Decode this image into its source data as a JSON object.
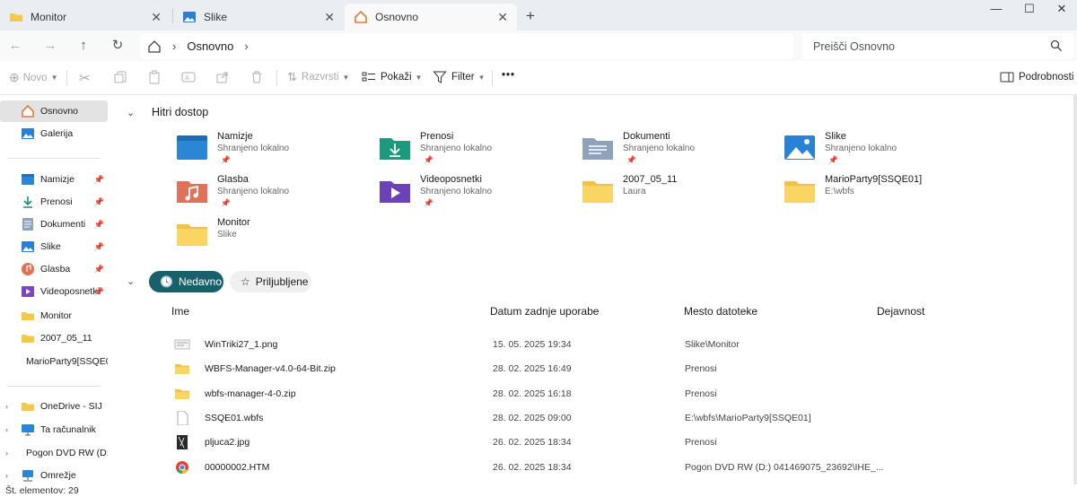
{
  "tabs": [
    {
      "label": "Monitor",
      "icon": "folder-icon"
    },
    {
      "label": "Slike",
      "icon": "pictures-icon"
    },
    {
      "label": "Osnovno",
      "icon": "home-icon"
    }
  ],
  "window_controls": {
    "minimize": "—",
    "maximize": "☐",
    "close": "✕"
  },
  "address": {
    "segment": "Osnovno"
  },
  "search": {
    "placeholder": "Preišči Osnovno"
  },
  "toolbar": {
    "new_label": "Novo",
    "sort_label": "Razvrsti",
    "view_label": "Pokaži",
    "filter_label": "Filter",
    "more_label": "•••",
    "details_label": "Podrobnosti"
  },
  "sidebar": {
    "items": [
      {
        "label": "Osnovno",
        "icon": "home-icon"
      },
      {
        "label": "Galerija",
        "icon": "gallery-icon"
      },
      {
        "label": "Namizje",
        "icon": "desktop-icon"
      },
      {
        "label": "Prenosi",
        "icon": "downloads-icon"
      },
      {
        "label": "Dokumenti",
        "icon": "documents-icon"
      },
      {
        "label": "Slike",
        "icon": "pictures-icon"
      },
      {
        "label": "Glasba",
        "icon": "music-icon"
      },
      {
        "label": "Videoposnetki",
        "icon": "videos-icon"
      },
      {
        "label": "Monitor",
        "icon": "folder-icon"
      },
      {
        "label": "2007_05_11",
        "icon": "folder-icon"
      },
      {
        "label": "MarioParty9[SSQE0",
        "icon": "folder-icon"
      },
      {
        "label": "OneDrive - SIJ",
        "icon": "onedrive-icon"
      },
      {
        "label": "Ta računalnik",
        "icon": "computer-icon"
      },
      {
        "label": "Pogon DVD RW (D:",
        "icon": "dvd-drive-icon"
      },
      {
        "label": "Omrežje",
        "icon": "network-icon"
      }
    ]
  },
  "quick_access": {
    "title": "Hitri dostop",
    "items": [
      {
        "name": "Namizje",
        "sub": "Shranjeno lokalno",
        "pinned": true,
        "icon": "desktop-icon"
      },
      {
        "name": "Prenosi",
        "sub": "Shranjeno lokalno",
        "pinned": true,
        "icon": "downloads-icon"
      },
      {
        "name": "Dokumenti",
        "sub": "Shranjeno lokalno",
        "pinned": true,
        "icon": "documents-icon"
      },
      {
        "name": "Slike",
        "sub": "Shranjeno lokalno",
        "pinned": true,
        "icon": "pictures-icon"
      },
      {
        "name": "Glasba",
        "sub": "Shranjeno lokalno",
        "pinned": true,
        "icon": "music-icon"
      },
      {
        "name": "Videoposnetki",
        "sub": "Shranjeno lokalno",
        "pinned": true,
        "icon": "videos-icon"
      },
      {
        "name": "2007_05_11",
        "sub": "Laura",
        "pinned": false,
        "icon": "folder-icon"
      },
      {
        "name": "MarioParty9[SSQE01]",
        "sub": "E:\\wbfs",
        "pinned": false,
        "icon": "folder-icon"
      },
      {
        "name": "Monitor",
        "sub": "Slike",
        "pinned": false,
        "icon": "folder-icon"
      }
    ]
  },
  "recent": {
    "chip_recent": "Nedavno",
    "chip_favorites": "Priljubljene",
    "columns": [
      "Ime",
      "Datum zadnje uporabe",
      "Mesto datoteke",
      "Dejavnost"
    ],
    "rows": [
      {
        "name": "WinTriki27_1.png",
        "date": "15. 05. 2025 19:34",
        "location": "Slike\\Monitor",
        "icon": "image-file-icon"
      },
      {
        "name": "WBFS-Manager-v4.0-64-Bit.zip",
        "date": "28. 02. 2025 16:49",
        "location": "Prenosi",
        "icon": "zip-folder-icon"
      },
      {
        "name": "wbfs-manager-4-0.zip",
        "date": "28. 02. 2025 16:18",
        "location": "Prenosi",
        "icon": "zip-folder-icon"
      },
      {
        "name": "SSQE01.wbfs",
        "date": "28. 02. 2025 09:00",
        "location": "E:\\wbfs\\MarioParty9[SSQE01]",
        "icon": "blank-file-icon"
      },
      {
        "name": "pljuca2.jpg",
        "date": "26. 02. 2025 18:34",
        "location": "Prenosi",
        "icon": "photo-file-icon"
      },
      {
        "name": "00000002.HTM",
        "date": "26. 02. 2025 18:34",
        "location": "Pogon DVD RW (D:) 041469075_23692\\IHE_...",
        "icon": "chrome-html-icon"
      }
    ]
  },
  "status": {
    "count_text": "Št. elementov: 29"
  },
  "pin_glyph": "📌",
  "colors": {
    "accent": "#19606d",
    "folder": "#f5c84c",
    "selection": "#e3e3e3"
  }
}
